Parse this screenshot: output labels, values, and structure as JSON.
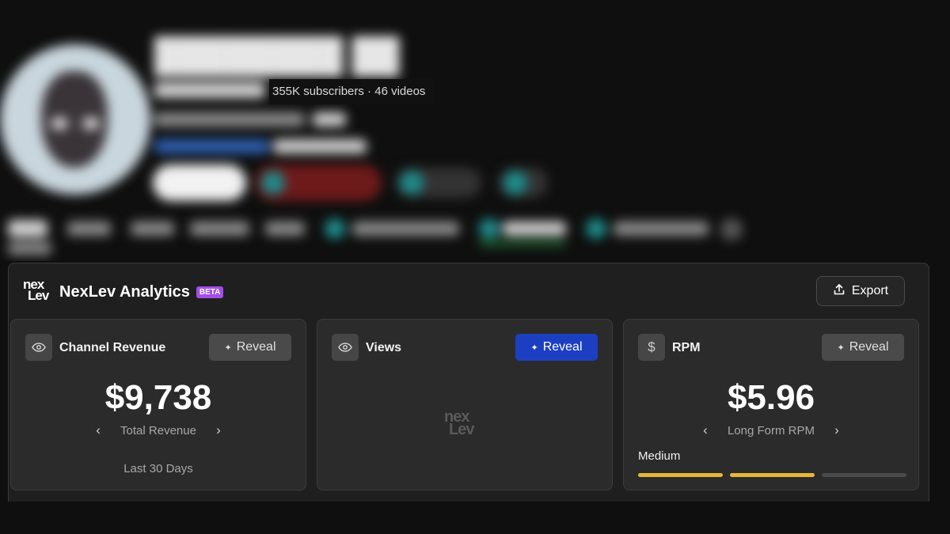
{
  "channel": {
    "stats_tooltip": "355K subscribers · 46 videos"
  },
  "panel": {
    "brand_name": "NexLev Analytics",
    "logo_text_top": "nex",
    "logo_text_bottom": "Lev",
    "badge": "BETA",
    "export_label": "Export",
    "cards": [
      {
        "title": "Channel Revenue",
        "icon": "eye-icon",
        "reveal_label": "Reveal",
        "value": "$9,738",
        "metric_label": "Total Revenue",
        "period": "Last 30 Days"
      },
      {
        "title": "Views",
        "icon": "eye-icon",
        "reveal_label": "Reveal",
        "reveal_state": "primary"
      },
      {
        "title": "RPM",
        "icon": "dollar-icon",
        "icon_glyph": "$",
        "reveal_label": "Reveal",
        "value": "$5.96",
        "metric_label": "Long Form RPM",
        "tier_label": "Medium",
        "tier_level": 2,
        "tier_max": 3
      }
    ]
  },
  "colors": {
    "accent_blue": "#1c3fc2",
    "beta_purple": "#a34ee8",
    "tier_yellow": "#e6b738"
  }
}
